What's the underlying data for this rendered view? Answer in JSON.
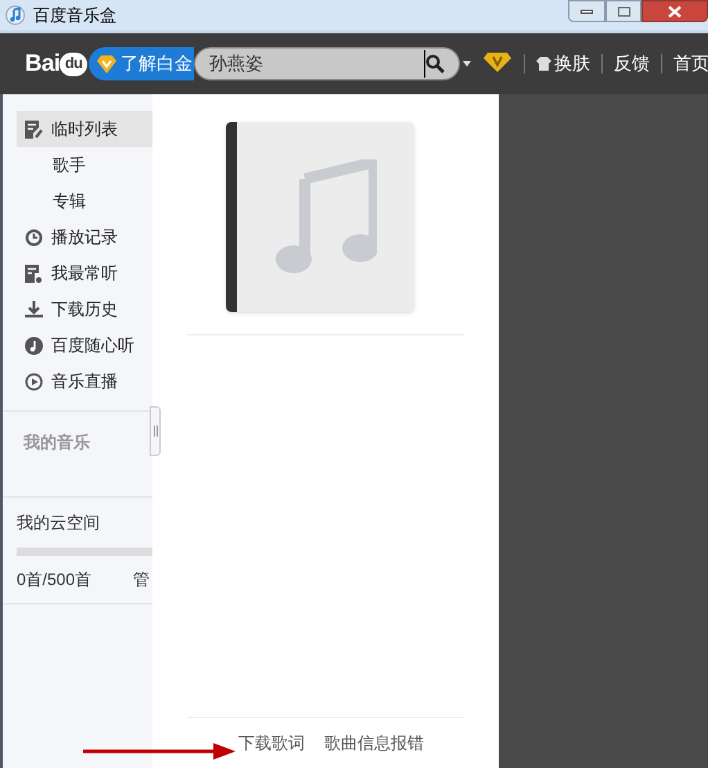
{
  "window": {
    "title": "百度音乐盒"
  },
  "toolbar": {
    "logo": {
      "text": "Bai",
      "paw": "du"
    },
    "promo_button": "了解白金",
    "search": {
      "value": "孙燕姿"
    },
    "links": [
      "换肤",
      "反馈",
      "首页"
    ]
  },
  "sidebar": {
    "items": [
      {
        "label": "临时列表",
        "kind": "edit",
        "selected": true
      },
      {
        "label": "歌手",
        "kind": "sub",
        "selected": false
      },
      {
        "label": "专辑",
        "kind": "sub",
        "selected": false
      },
      {
        "label": "播放记录",
        "kind": "history",
        "selected": false
      },
      {
        "label": "我最常听",
        "kind": "list",
        "selected": false
      },
      {
        "label": "下载历史",
        "kind": "download",
        "selected": false
      },
      {
        "label": "百度随心听",
        "kind": "note",
        "selected": false
      },
      {
        "label": "音乐直播",
        "kind": "play",
        "selected": false
      }
    ],
    "my_music": "我的音乐",
    "cloud": {
      "title": "我的云空间",
      "level": 0,
      "usage": "0首/500首",
      "action": "管"
    }
  },
  "lyrics_links": [
    "下载歌词",
    "歌曲信息报错"
  ]
}
